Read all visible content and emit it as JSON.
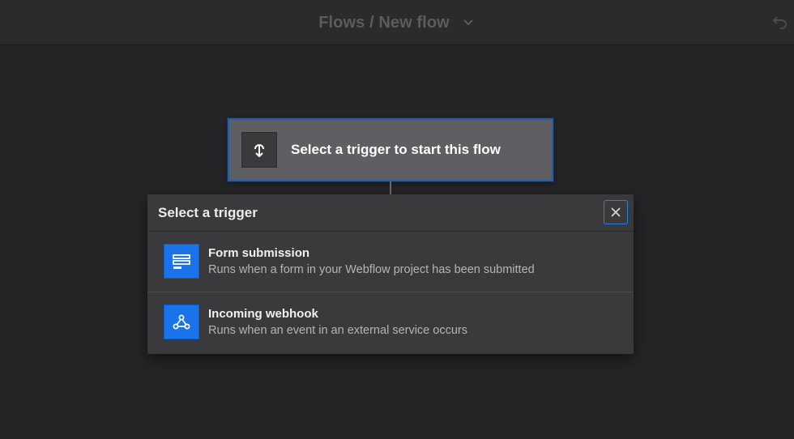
{
  "header": {
    "title": "Flows / New flow"
  },
  "trigger_card": {
    "label": "Select a trigger to start this flow"
  },
  "dialog": {
    "title": "Select a trigger",
    "options": [
      {
        "title": "Form submission",
        "description": "Runs when a form in your Webflow project has been submitted",
        "icon": "form-icon"
      },
      {
        "title": "Incoming webhook",
        "description": "Runs when an event in an external service occurs",
        "icon": "webhook-icon"
      }
    ]
  },
  "colors": {
    "accent": "#1a73e8",
    "background": "#252527",
    "panel": "#3a393c"
  }
}
